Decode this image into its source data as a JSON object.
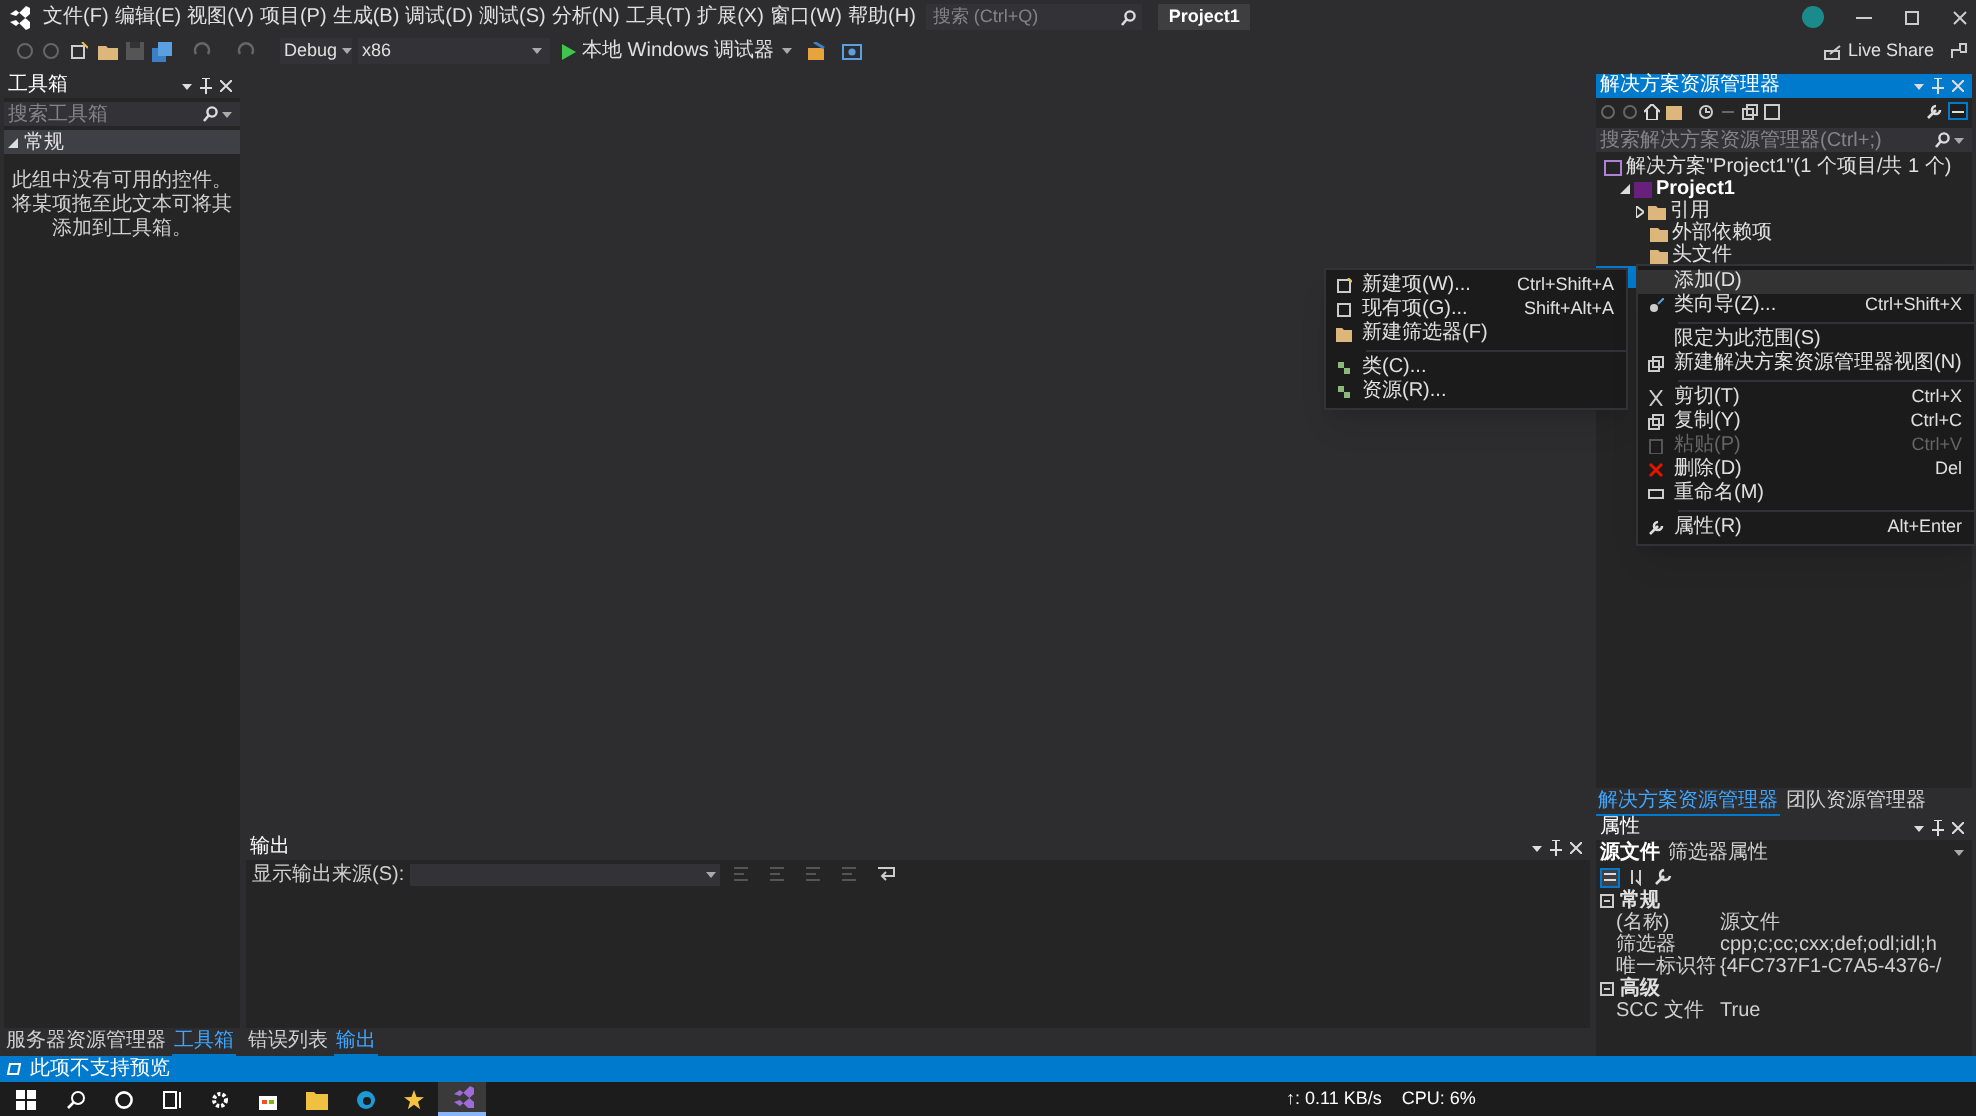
{
  "menu": [
    "文件(F)",
    "编辑(E)",
    "视图(V)",
    "项目(P)",
    "生成(B)",
    "调试(D)",
    "测试(S)",
    "分析(N)",
    "工具(T)",
    "扩展(X)",
    "窗口(W)",
    "帮助(H)"
  ],
  "search": {
    "placeholder": "搜索 (Ctrl+Q)"
  },
  "title": "Project1",
  "live_share": "Live Share",
  "toolbar": {
    "configuration": "Debug",
    "platform": "x86",
    "run": "本地 Windows 调试器"
  },
  "toolbox": {
    "title": "工具箱",
    "search": {
      "placeholder": "搜索工具箱"
    },
    "group": {
      "label": "常规",
      "expanded": true
    },
    "empty_text": "此组中没有可用的控件。将某项拖至此文本可将其添加到工具箱。"
  },
  "left_tabs": [
    {
      "label": "服务器资源管理器",
      "selected": false
    },
    {
      "label": "工具箱",
      "selected": true
    }
  ],
  "solution_explorer": {
    "title": "解决方案资源管理器",
    "search": {
      "placeholder": "搜索解决方案资源管理器(Ctrl+;)"
    },
    "tree": [
      {
        "label": "解决方案\"Project1\"(1 个项目/共 1 个)",
        "selected": false,
        "children": [
          {
            "label": "Project1",
            "expanded": true,
            "selected": false,
            "children": [
              {
                "label": "引用",
                "expanded": false,
                "selected": false
              },
              {
                "label": "外部依赖项",
                "selected": false
              },
              {
                "label": "头文件",
                "selected": false
              },
              {
                "selected": true
              }
            ]
          }
        ]
      }
    ]
  },
  "right_tabs": [
    {
      "label": "解决方案资源管理器",
      "selected": true
    },
    {
      "label": "团队资源管理器",
      "selected": false
    }
  ],
  "properties": {
    "title": "属性",
    "object_name": "源文件",
    "object_type": "筛选器属性",
    "categories": [
      {
        "label": "常规",
        "expanded": true,
        "rows": [
          {
            "name": "(名称)",
            "value": "源文件"
          },
          {
            "name": "筛选器",
            "value": "cpp;c;cc;cxx;def;odl;idl;h"
          },
          {
            "name": "唯一标识符",
            "value": "{4FC737F1-C7A5-4376-/"
          }
        ]
      },
      {
        "label": "高级",
        "expanded": true,
        "rows": [
          {
            "name": "SCC 文件",
            "value": "True"
          }
        ]
      }
    ]
  },
  "output": {
    "title": "输出",
    "source_label": "显示输出来源(S):"
  },
  "bottom_tabs": [
    {
      "label": "错误列表",
      "selected": false
    },
    {
      "label": "输出",
      "selected": true
    }
  ],
  "status": "此项不支持预览",
  "context_menu": [
    {
      "kind": "item",
      "label": "添加(D)",
      "selected": true,
      "disabled": false
    },
    {
      "kind": "item",
      "label": "类向导(Z)...",
      "shortcut": "Ctrl+Shift+X",
      "selected": false,
      "disabled": false
    },
    {
      "kind": "separator"
    },
    {
      "kind": "item",
      "label": "限定为此范围(S)",
      "selected": false,
      "disabled": false
    },
    {
      "kind": "item",
      "label": "新建解决方案资源管理器视图(N)",
      "selected": false,
      "disabled": false
    },
    {
      "kind": "separator"
    },
    {
      "kind": "item",
      "label": "剪切(T)",
      "shortcut": "Ctrl+X",
      "selected": false,
      "disabled": false
    },
    {
      "kind": "item",
      "label": "复制(Y)",
      "shortcut": "Ctrl+C",
      "selected": false,
      "disabled": false
    },
    {
      "kind": "item",
      "label": "粘贴(P)",
      "shortcut": "Ctrl+V",
      "selected": false,
      "disabled": true
    },
    {
      "kind": "item",
      "label": "删除(D)",
      "shortcut": "Del",
      "selected": false,
      "disabled": false
    },
    {
      "kind": "item",
      "label": "重命名(M)",
      "selected": false,
      "disabled": false
    },
    {
      "kind": "separator"
    },
    {
      "kind": "item",
      "label": "属性(R)",
      "shortcut": "Alt+Enter",
      "selected": false,
      "disabled": false
    }
  ],
  "submenu": [
    {
      "kind": "item",
      "label": "新建项(W)...",
      "shortcut": "Ctrl+Shift+A"
    },
    {
      "kind": "item",
      "label": "现有项(G)...",
      "shortcut": "Shift+Alt+A"
    },
    {
      "kind": "item",
      "label": "新建筛选器(F)"
    },
    {
      "kind": "separator"
    },
    {
      "kind": "item",
      "label": "类(C)..."
    },
    {
      "kind": "item",
      "label": "资源(R)..."
    }
  ],
  "taskbar": {
    "network": "↑: 0.11 KB/s",
    "cpu": "CPU: 6%"
  }
}
